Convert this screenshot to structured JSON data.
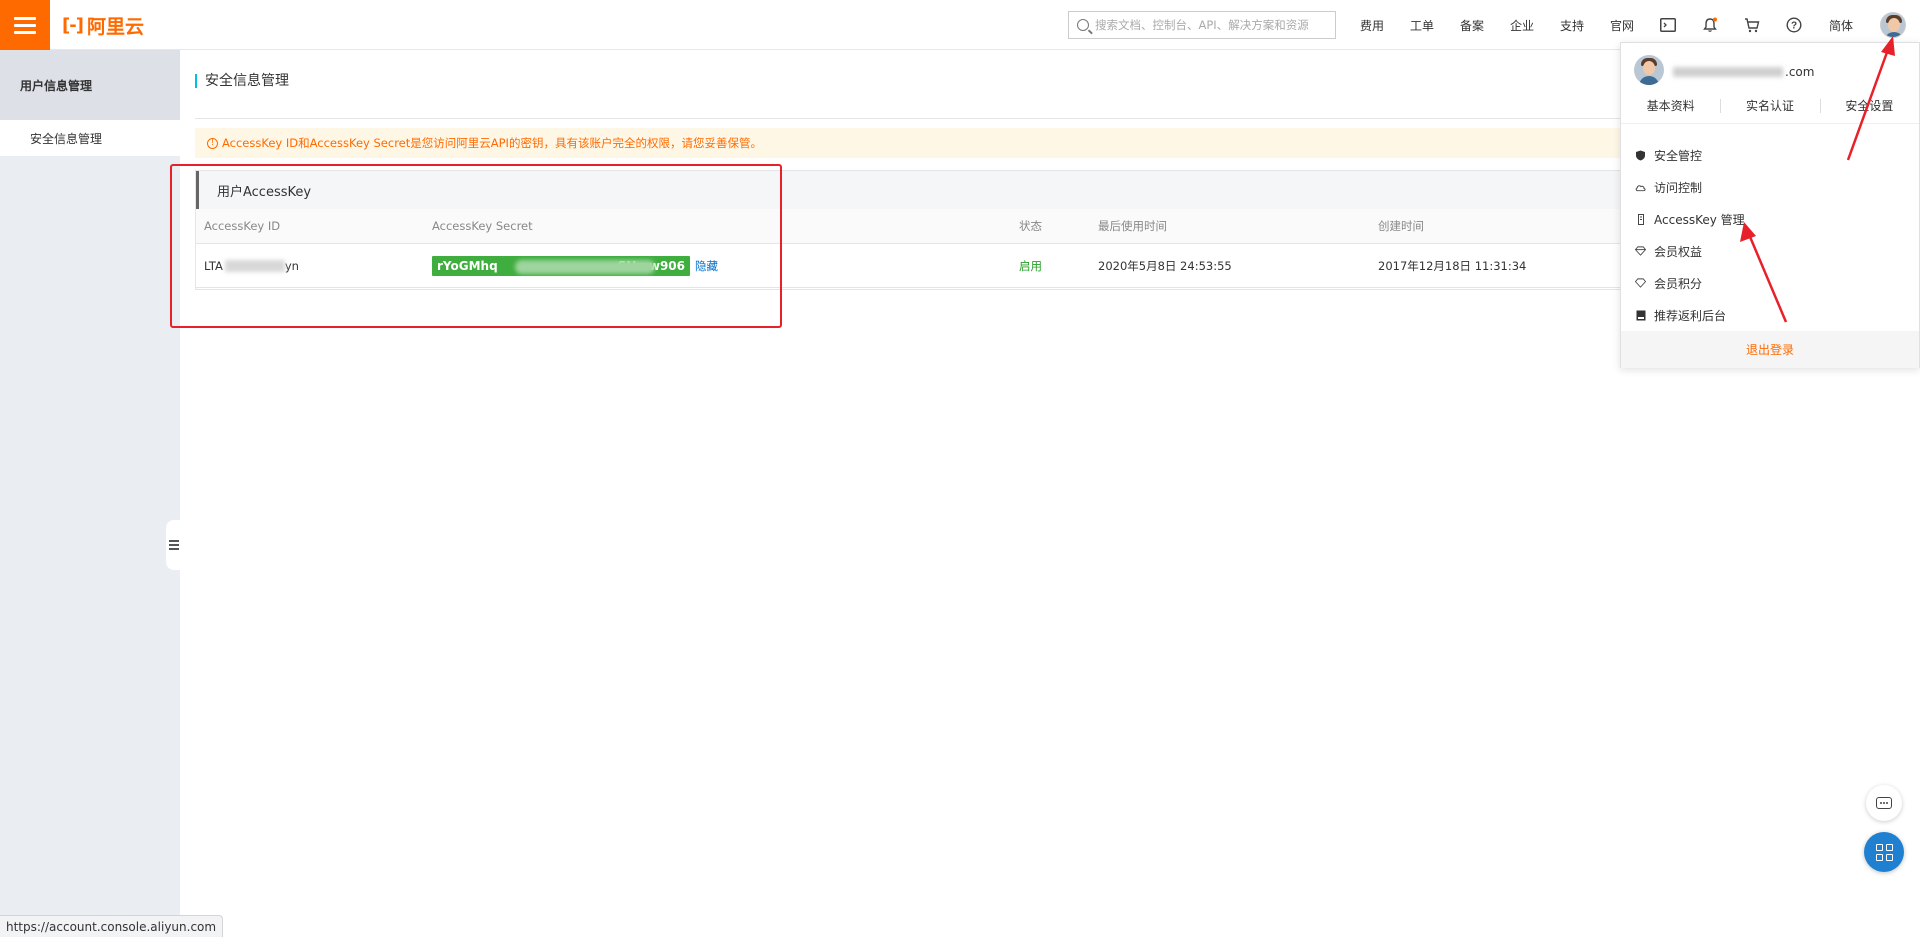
{
  "header": {
    "logo_text": "阿里云",
    "search_placeholder": "搜索文档、控制台、API、解决方案和资源",
    "nav": [
      "费用",
      "工单",
      "备案",
      "企业",
      "支持",
      "官网"
    ],
    "lang": "简体"
  },
  "sidebar": {
    "title": "用户信息管理",
    "items": [
      {
        "label": "安全信息管理"
      }
    ]
  },
  "main": {
    "page_title": "安全信息管理",
    "notice": "AccessKey ID和AccessKey Secret是您访问阿里云API的密钥，具有该账户完全的权限，请您妥善保管。",
    "ak_section_title": "用户AccessKey",
    "columns": [
      "AccessKey ID",
      "AccessKey Secret",
      "状态",
      "最后使用时间",
      "创建时间"
    ],
    "rows": [
      {
        "id_prefix": "LTA",
        "id_suffix": "yn",
        "secret_prefix": "rYoGMhq",
        "secret_suffix": "SHmw906",
        "hide_label": "隐藏",
        "status": "启用",
        "last_used": "2020年5月8日 24:53:55",
        "created": "2017年12月18日 11:31:34"
      }
    ]
  },
  "dropdown": {
    "email_suffix": ".com",
    "tabs": [
      "基本资料",
      "实名认证",
      "安全设置"
    ],
    "items": [
      {
        "label": "安全管控",
        "icon": "shield-icon"
      },
      {
        "label": "访问控制",
        "icon": "cloud-icon"
      },
      {
        "label": "AccessKey 管理",
        "icon": "key-icon"
      },
      {
        "label": "会员权益",
        "icon": "diamond-icon"
      },
      {
        "label": "会员积分",
        "icon": "diamond-outline-icon"
      },
      {
        "label": "推荐返利后台",
        "icon": "book-icon"
      }
    ],
    "logout": "退出登录"
  },
  "statusbar": {
    "url": "https://account.console.aliyun.com"
  },
  "colors": {
    "brand": "#ff6a00",
    "highlight_box": "#e8202a",
    "status_ok": "#2a9d2a",
    "link": "#0070cc"
  }
}
